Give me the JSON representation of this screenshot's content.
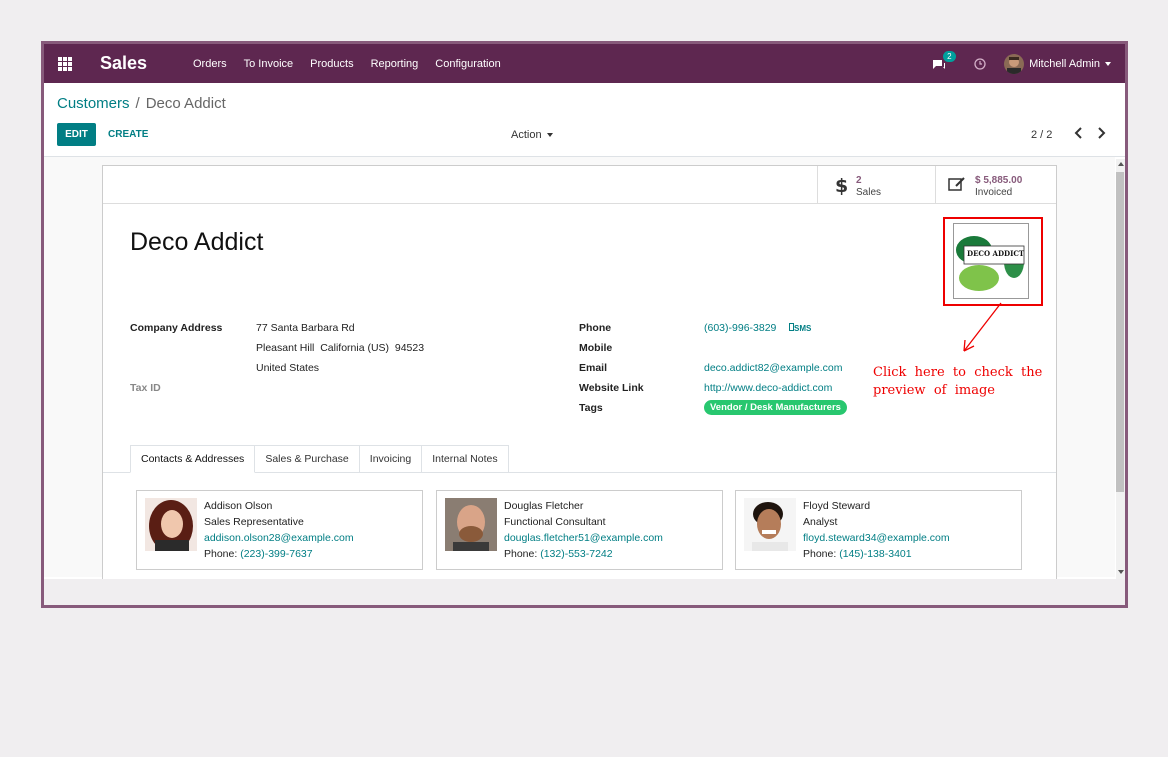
{
  "navbar": {
    "app_name": "Sales",
    "menu": [
      "Orders",
      "To Invoice",
      "Products",
      "Reporting",
      "Configuration"
    ],
    "message_count": "2",
    "user_name": "Mitchell Admin",
    "color": "#5e2750"
  },
  "breadcrumb": {
    "parent": "Customers",
    "separator": "/",
    "current": "Deco Addict"
  },
  "toolbar": {
    "edit_label": "EDIT",
    "create_label": "CREATE",
    "action_label": "Action",
    "pager": "2 / 2"
  },
  "stats": {
    "sales_count": "2",
    "sales_label": "Sales",
    "invoiced_amount": "$ 5,885.00",
    "invoiced_label": "Invoiced"
  },
  "partner": {
    "name": "Deco Addict",
    "logo_text": "DECO ADDICT",
    "company_address_label": "Company Address",
    "address_line1": "77 Santa Barbara Rd",
    "address_line2": "Pleasant Hill  California (US)  94523",
    "address_line3": "United States",
    "tax_id_label": "Tax ID",
    "phone_label": "Phone",
    "phone": "(603)-996-3829",
    "sms_label": "SMS",
    "mobile_label": "Mobile",
    "email_label": "Email",
    "email": "deco.addict82@example.com",
    "website_label": "Website Link",
    "website": "http://www.deco-addict.com",
    "tags_label": "Tags",
    "tag": "Vendor / Desk Manufacturers"
  },
  "annotation": {
    "line1": "Click  here  to  check  the",
    "line2": "preview  of  image"
  },
  "tabs": [
    "Contacts & Addresses",
    "Sales & Purchase",
    "Invoicing",
    "Internal Notes"
  ],
  "contacts": [
    {
      "name": "Addison Olson",
      "role": "Sales Representative",
      "email": "addison.olson28@example.com",
      "phone_label": "Phone: ",
      "phone": "(223)-399-7637"
    },
    {
      "name": "Douglas Fletcher",
      "role": "Functional Consultant",
      "email": "douglas.fletcher51@example.com",
      "phone_label": "Phone: ",
      "phone": "(132)-553-7242"
    },
    {
      "name": "Floyd Steward",
      "role": "Analyst",
      "email": "floyd.steward34@example.com",
      "phone_label": "Phone: ",
      "phone": "(145)-138-3401"
    }
  ]
}
